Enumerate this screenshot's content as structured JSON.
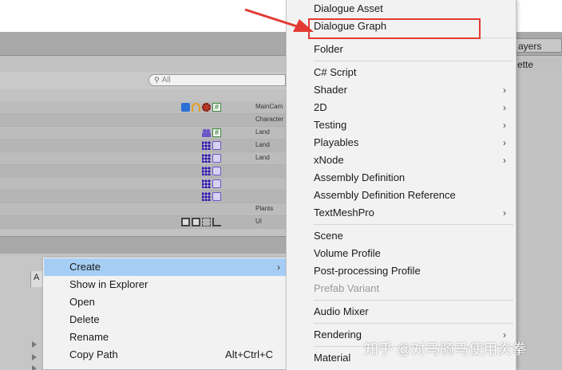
{
  "panel": {
    "tab_layers": "ayers",
    "tab_palette": "ette",
    "search_placeholder": "All"
  },
  "layer_rows": [
    {
      "label": "MainCam",
      "icons": [
        "camera-icon",
        "headphones-icon",
        "gear-icon",
        "script-icon"
      ]
    },
    {
      "label": "Character",
      "icons": []
    },
    {
      "label": "Land",
      "icons": [
        "people-icon",
        "script-icon"
      ]
    },
    {
      "label": "Land",
      "icons": [
        "grid-icon",
        "eye-icon"
      ]
    },
    {
      "label": "Land",
      "icons": [
        "grid-icon",
        "eye-icon"
      ]
    },
    {
      "label": "",
      "icons": [
        "grid-icon",
        "eye-icon"
      ]
    },
    {
      "label": "",
      "icons": [
        "grid-icon",
        "eye-icon"
      ]
    },
    {
      "label": "",
      "icons": [
        "grid-icon",
        "eye-icon"
      ]
    },
    {
      "label": "Plants",
      "icons": []
    },
    {
      "label": "UI",
      "icons": [
        "rect-tool-icon",
        "rect-tool-icon",
        "rect-transform-icon",
        "move-tool-icon"
      ]
    }
  ],
  "lower_panel": {
    "column_header": "A"
  },
  "context_menu": {
    "items": [
      {
        "label": "Create",
        "has_submenu": true,
        "selected": true
      },
      {
        "label": "Show in Explorer"
      },
      {
        "label": "Open"
      },
      {
        "label": "Delete"
      },
      {
        "label": "Rename"
      },
      {
        "label": "Copy Path",
        "shortcut": "Alt+Ctrl+C"
      }
    ],
    "submenu_arrow": "›"
  },
  "create_submenu": {
    "arrow": "›",
    "groups": [
      [
        {
          "label": "Dialogue Asset"
        },
        {
          "label": "Dialogue Graph",
          "highlighted": true
        }
      ],
      [
        {
          "label": "Folder"
        }
      ],
      [
        {
          "label": "C# Script"
        },
        {
          "label": "Shader",
          "has_submenu": true
        },
        {
          "label": "2D",
          "has_submenu": true
        },
        {
          "label": "Testing",
          "has_submenu": true
        },
        {
          "label": "Playables",
          "has_submenu": true
        },
        {
          "label": "xNode",
          "has_submenu": true
        },
        {
          "label": "Assembly Definition"
        },
        {
          "label": "Assembly Definition Reference"
        },
        {
          "label": "TextMeshPro",
          "has_submenu": true
        }
      ],
      [
        {
          "label": "Scene"
        },
        {
          "label": "Volume Profile"
        },
        {
          "label": "Post-processing Profile"
        },
        {
          "label": "Prefab Variant",
          "disabled": true
        }
      ],
      [
        {
          "label": "Audio Mixer"
        }
      ],
      [
        {
          "label": "Rendering",
          "has_submenu": true
        }
      ],
      [
        {
          "label": "Material"
        }
      ]
    ]
  },
  "annotation": {
    "color": "#e23a32"
  },
  "watermark": "知乎 @对马骑马使用炎拳"
}
